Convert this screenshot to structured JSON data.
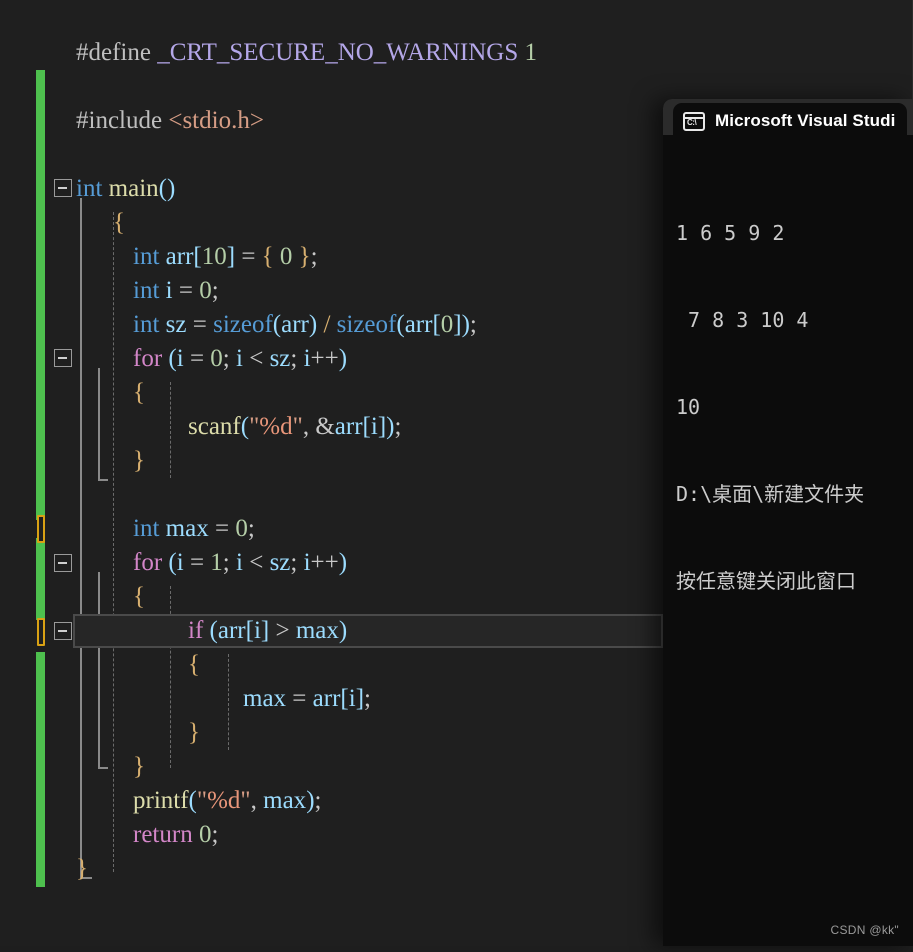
{
  "editor": {
    "language": "c",
    "background_color": "#1f1f1f",
    "change_bar_color": "#4ec04e",
    "bookmark_marker_color": "#d9a114",
    "current_line": {
      "text": "if (arr[i] > max)",
      "line_index": 17,
      "highlight_color": "#262626",
      "border_color": "#4a4a4a"
    },
    "lines": [
      {
        "indent": 0,
        "text": "#define _CRT_SECURE_NO_WARNINGS 1"
      },
      {
        "indent": 0,
        "text": ""
      },
      {
        "indent": 0,
        "text": "#include <stdio.h>"
      },
      {
        "indent": 0,
        "text": ""
      },
      {
        "indent": 0,
        "text": "int main()"
      },
      {
        "indent": 0,
        "text": "{"
      },
      {
        "indent": 1,
        "text": "int arr[10] = { 0 };"
      },
      {
        "indent": 1,
        "text": "int i = 0;"
      },
      {
        "indent": 1,
        "text": "int sz = sizeof(arr) / sizeof(arr[0]);"
      },
      {
        "indent": 1,
        "text": "for (i = 0; i < sz; i++)"
      },
      {
        "indent": 1,
        "text": "{"
      },
      {
        "indent": 2,
        "text": "scanf(\"%d\", &arr[i]);"
      },
      {
        "indent": 1,
        "text": "}"
      },
      {
        "indent": 0,
        "text": ""
      },
      {
        "indent": 1,
        "text": "int max = 0;"
      },
      {
        "indent": 1,
        "text": "for (i = 1; i < sz; i++)"
      },
      {
        "indent": 1,
        "text": "{"
      },
      {
        "indent": 2,
        "text": "if (arr[i] > max)"
      },
      {
        "indent": 2,
        "text": "{"
      },
      {
        "indent": 3,
        "text": "max = arr[i];"
      },
      {
        "indent": 2,
        "text": "}"
      },
      {
        "indent": 1,
        "text": "}"
      },
      {
        "indent": 1,
        "text": "printf(\"%d\", max);"
      },
      {
        "indent": 1,
        "text": "return 0;"
      },
      {
        "indent": 0,
        "text": "}"
      }
    ]
  },
  "console": {
    "title": "Microsoft Visual Studi",
    "icon": "command-prompt-icon",
    "icon_label": "C:\\",
    "background_color": "#0c0c0c",
    "output_lines": [
      "1 6 5 9 2",
      " 7 8 3 10 4",
      "10",
      "D:\\桌面\\新建文件夹",
      "按任意键关闭此窗口"
    ]
  },
  "watermark": {
    "text": "CSDN @kk\""
  }
}
